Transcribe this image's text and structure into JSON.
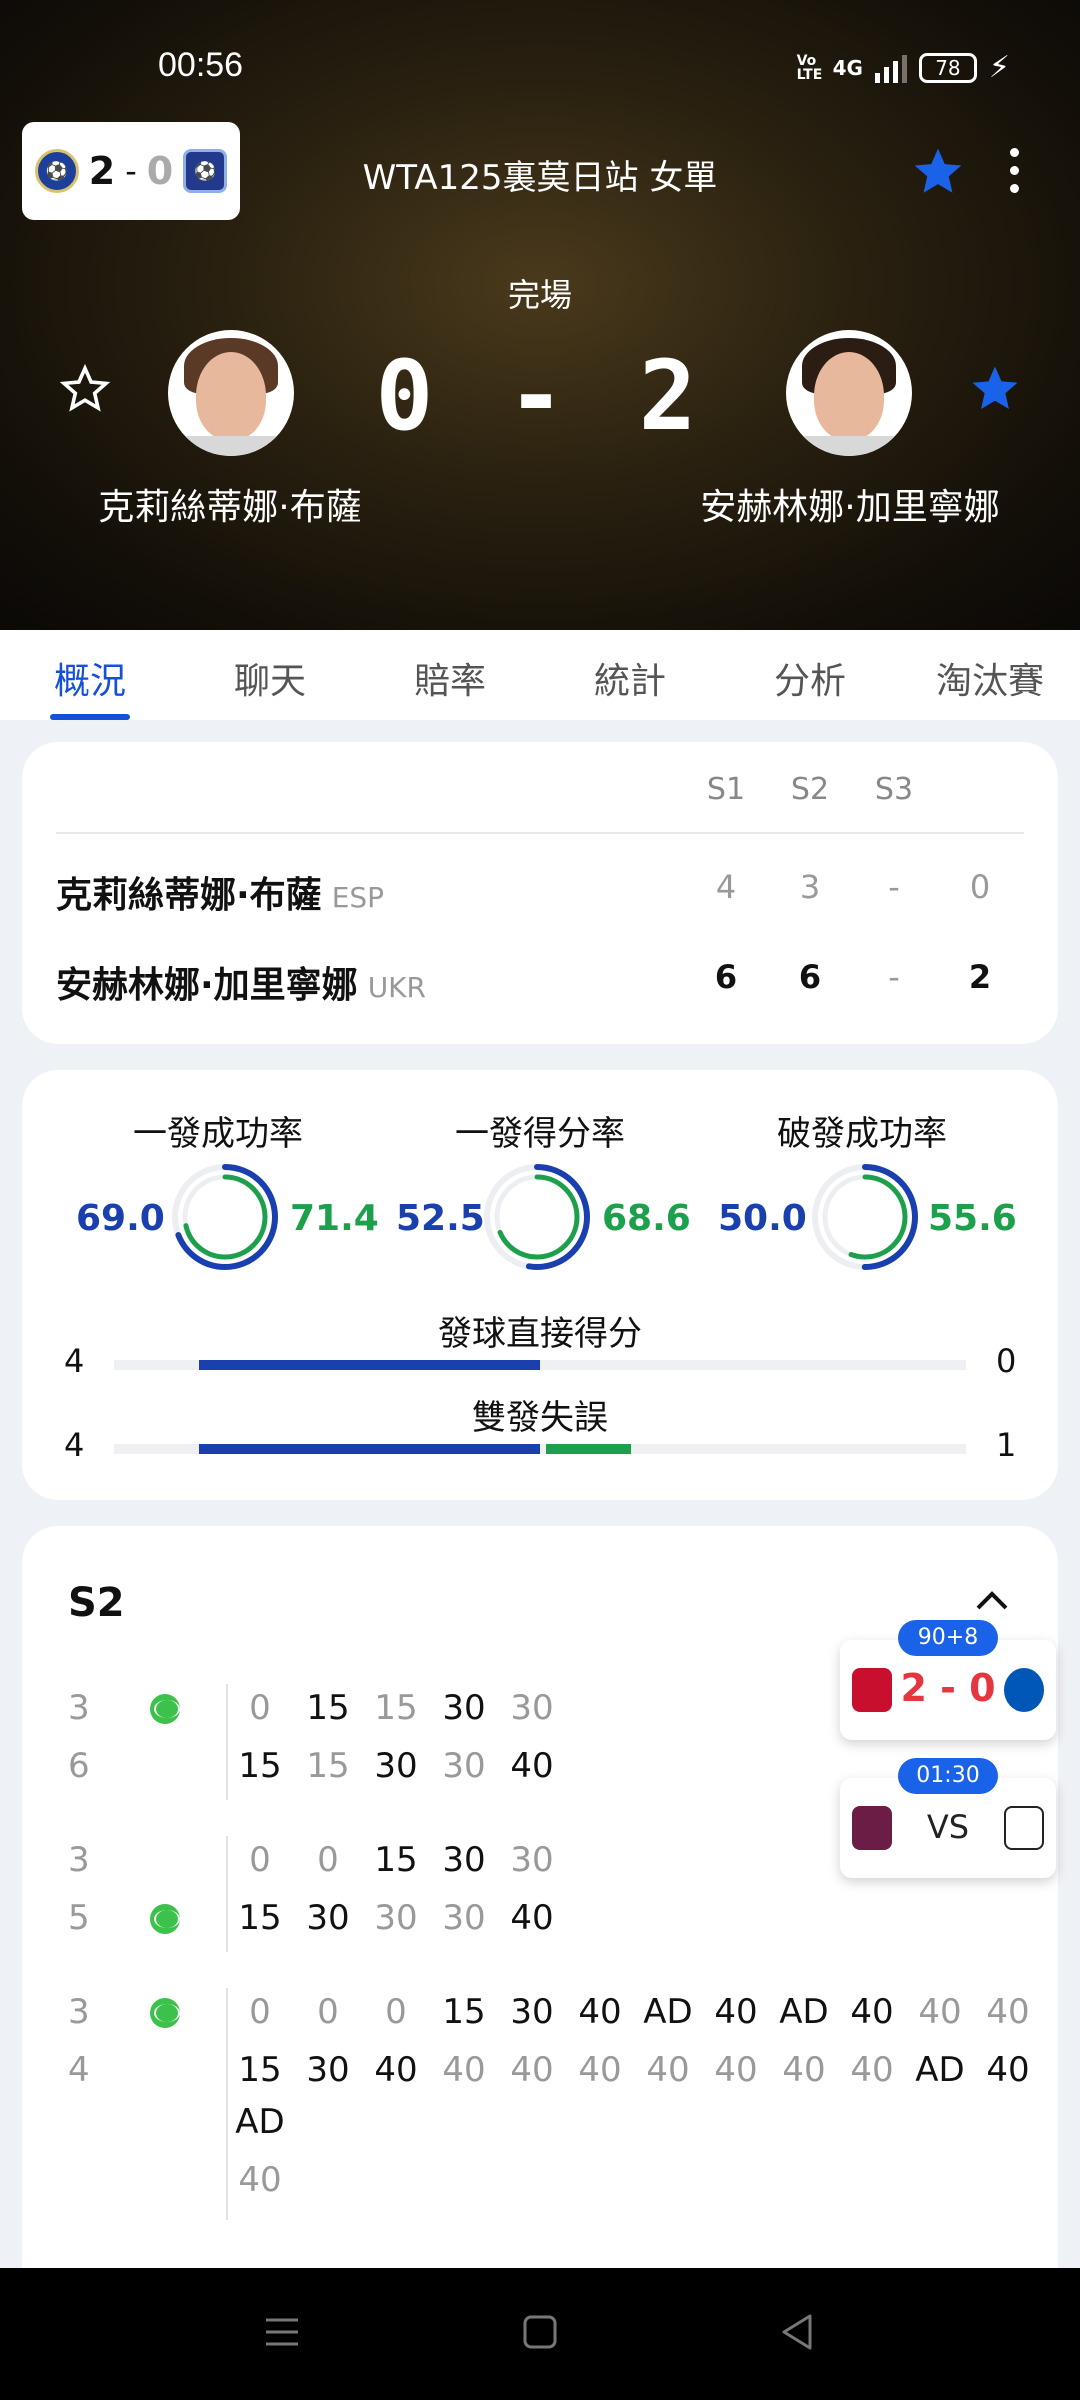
{
  "status": {
    "time": "00:56",
    "volte": "Vo LTE",
    "net": "4G",
    "battery": "78"
  },
  "mini_match": {
    "home_score": "2",
    "sep": "-",
    "away_score": "0"
  },
  "header": {
    "title": "WTA125裏莫日站 女單",
    "status": "完場",
    "score": "0 - 2",
    "player1": "克莉絲蒂娜·布薩",
    "player2": "安赫林娜·加里寧娜"
  },
  "tabs": [
    "概況",
    "聊天",
    "賠率",
    "統計",
    "分析",
    "淘汰賽"
  ],
  "sets": {
    "headers": [
      "S1",
      "S2",
      "S3"
    ],
    "rows": [
      {
        "name": "克莉絲蒂娜·布薩",
        "country": "ESP",
        "s1": "4",
        "s2": "3",
        "s3": "-",
        "total": "0"
      },
      {
        "name": "安赫林娜·加里寧娜",
        "country": "UKR",
        "s1": "6",
        "s2": "6",
        "s3": "-",
        "total": "2"
      }
    ]
  },
  "stats": {
    "rings": [
      {
        "title": "一發成功率",
        "left": "69.0",
        "right": "71.4",
        "left_pct": 0.69,
        "right_pct": 0.714
      },
      {
        "title": "一發得分率",
        "left": "52.5",
        "right": "68.6",
        "left_pct": 0.525,
        "right_pct": 0.686
      },
      {
        "title": "破發成功率",
        "left": "50.0",
        "right": "55.6",
        "left_pct": 0.5,
        "right_pct": 0.556
      }
    ],
    "bars": [
      {
        "title": "發球直接得分",
        "left": "4",
        "right": "0",
        "left_val": 4,
        "right_val": 0
      },
      {
        "title": "雙發失誤",
        "left": "4",
        "right": "1",
        "left_val": 4,
        "right_val": 1
      }
    ],
    "colors": {
      "player1": "#1a3fae",
      "player2": "#1ca04b"
    }
  },
  "pbp": {
    "title": "S2",
    "games": [
      {
        "top": "3",
        "bottom": "6",
        "server": "top",
        "top_pts": [
          "0",
          "15",
          "15",
          "30",
          "30"
        ],
        "bottom_pts": [
          "15",
          "15",
          "30",
          "30",
          "40"
        ]
      },
      {
        "top": "3",
        "bottom": "5",
        "server": "bottom",
        "top_pts": [
          "0",
          "0",
          "15",
          "30",
          "30"
        ],
        "bottom_pts": [
          "15",
          "30",
          "30",
          "30",
          "40"
        ]
      },
      {
        "top": "3",
        "bottom": "4",
        "server": "top",
        "top_pts": [
          "0",
          "0",
          "0",
          "15",
          "30",
          "40",
          "AD",
          "40",
          "AD",
          "40",
          "40",
          "40"
        ],
        "bottom_pts": [
          "15",
          "30",
          "40",
          "40",
          "40",
          "40",
          "40",
          "40",
          "40",
          "40",
          "AD",
          "40"
        ],
        "extra": [
          "AD",
          "40"
        ]
      }
    ]
  },
  "live": [
    {
      "clock": "90+8",
      "score": "2 - 0"
    },
    {
      "clock": "01:30",
      "score": "VS"
    }
  ]
}
